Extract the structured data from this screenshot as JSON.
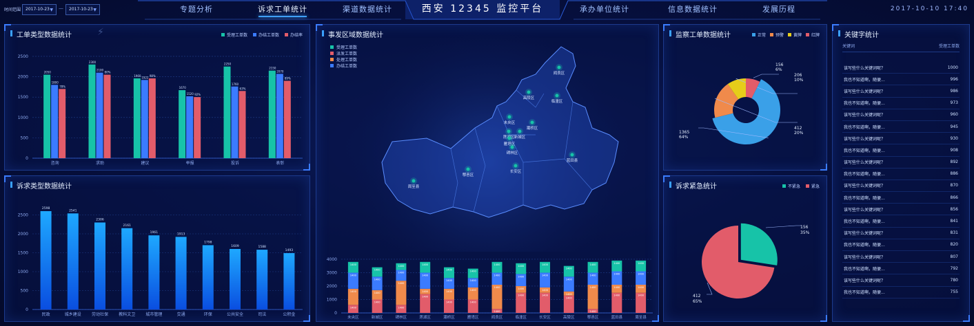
{
  "header": {
    "time_range_label": "时间范围",
    "date_from": "2017-10-23",
    "date_to": "2017-10-23",
    "date_separator": "—",
    "title": "西安 12345 监控平台",
    "datetime": "2017-10-10 17:40",
    "tabs_left": [
      "专题分析",
      "诉求工单统计",
      "渠道数据统计"
    ],
    "tabs_right": [
      "承办单位统计",
      "信息数据统计",
      "发展历程"
    ],
    "active_tab": "诉求工单统计"
  },
  "panels": {
    "order_type": {
      "title": "工单类型数据统计",
      "legend": [
        "受理工单数",
        "办结工单数",
        "办结率"
      ]
    },
    "appeal_type": {
      "title": "诉求类型数据统计"
    },
    "region": {
      "title": "事发区域数据统计",
      "legend": [
        "受理工单数",
        "派发工单数",
        "处理工单数",
        "办结工单数"
      ]
    },
    "supervision": {
      "title": "监察工单数据统计",
      "legend": [
        "正常",
        "预警",
        "黄牌",
        "红牌"
      ]
    },
    "urgency": {
      "title": "诉求紧急统计",
      "legend": [
        "不紧急",
        "紧急"
      ]
    },
    "keywords": {
      "title": "关键字统计",
      "col_keyword": "关键词",
      "col_count": "受理工单数",
      "rows": [
        {
          "k": "该写些什么关键词呢？",
          "v": "1000"
        },
        {
          "k": "我也不知道啊，随便...",
          "v": "996"
        },
        {
          "k": "该写些什么关键词呢？",
          "v": "986"
        },
        {
          "k": "我也不知道啊，随便...",
          "v": "973"
        },
        {
          "k": "该写些什么关键词呢？",
          "v": "960"
        },
        {
          "k": "我也不知道啊，随便...",
          "v": "945"
        },
        {
          "k": "该写些什么关键词呢？",
          "v": "930"
        },
        {
          "k": "我也不知道啊，随便...",
          "v": "908"
        },
        {
          "k": "该写些什么关键词呢？",
          "v": "892"
        },
        {
          "k": "我也不知道啊，随便...",
          "v": "886"
        },
        {
          "k": "该写些什么关键词呢？",
          "v": "870"
        },
        {
          "k": "我也不知道啊，随便...",
          "v": "866"
        },
        {
          "k": "该写些什么关键词呢？",
          "v": "856"
        },
        {
          "k": "我也不知道啊，随便...",
          "v": "841"
        },
        {
          "k": "该写些什么关键词呢？",
          "v": "831"
        },
        {
          "k": "我也不知道啊，随便...",
          "v": "820"
        },
        {
          "k": "该写些什么关键词呢？",
          "v": "807"
        },
        {
          "k": "我也不知道啊，随便...",
          "v": "792"
        },
        {
          "k": "该写些什么关键词呢？",
          "v": "780"
        },
        {
          "k": "我也不知道啊，随便...",
          "v": "755"
        }
      ]
    }
  },
  "map": {
    "districts": [
      "阎良区",
      "高陵区",
      "临潼区",
      "未央区",
      "灞桥区",
      "莲湖区",
      "新城区",
      "雁塔区",
      "碑林区",
      "长安区",
      "鄠邑区",
      "周至县",
      "蓝田县"
    ]
  },
  "colors": {
    "teal": "#17c3a8",
    "blue": "#3b7bff",
    "red": "#e25c6a",
    "orange": "#f08a4b",
    "yellow": "#e6cd1a",
    "sky": "#3aa0e8"
  },
  "chart_data": [
    {
      "id": "order_type",
      "type": "bar",
      "categories": [
        "咨询",
        "求助",
        "建议",
        "举报",
        "投诉",
        "表彰"
      ],
      "series": [
        {
          "name": "受理工单数",
          "values": [
            2050,
            2300,
            1960,
            1670,
            2250,
            2150
          ]
        },
        {
          "name": "办结工单数",
          "values": [
            1800,
            2100,
            1920,
            1520,
            1760,
            2070
          ]
        },
        {
          "name": "办结率",
          "values": [
            1700,
            2050,
            1960,
            1500,
            1650,
            1900
          ]
        }
      ],
      "value_labels": [
        [
          "2050",
          "1800",
          "78%"
        ],
        [
          "2300",
          "2100",
          "80%"
        ],
        [
          "1960",
          "1922",
          "98%"
        ],
        [
          "1670",
          "1520",
          "92%"
        ],
        [
          "2250",
          "1760",
          "63%"
        ],
        [
          "2150",
          "2070",
          "89%"
        ]
      ],
      "yticks": [
        "0",
        "500",
        "1000",
        "1500",
        "2000",
        "2500"
      ],
      "ylim": [
        0,
        2600
      ]
    },
    {
      "id": "appeal_type",
      "type": "bar",
      "categories": [
        "民政",
        "城乡建设",
        "劳动社保",
        "教科文卫",
        "城市管理",
        "交通",
        "环保",
        "公共安全",
        "司法",
        "公积金"
      ],
      "values": [
        2600,
        2540,
        2300,
        2150,
        1960,
        1920,
        1700,
        1600,
        1580,
        1490
      ],
      "value_labels": [
        "2598",
        "2541",
        "2306",
        "2161",
        "1961",
        "1913",
        "1798",
        "1609",
        "1588",
        "1493"
      ],
      "yticks": [
        "0",
        "500",
        "1000",
        "1500",
        "2000",
        "2500"
      ],
      "ylim": [
        0,
        2800
      ]
    },
    {
      "id": "region",
      "type": "bar",
      "stacked": true,
      "categories": [
        "未央区",
        "新城区",
        "碑林区",
        "莲湖区",
        "灞桥区",
        "雁塔区",
        "阎良区",
        "临潼区",
        "长安区",
        "高陵区",
        "鄠邑区",
        "蓝田县",
        "周至县"
      ],
      "series": [
        {
          "name": "受理工单数",
          "values": [
            800,
            700,
            500,
            800,
            800,
            700,
            800,
            800,
            800,
            800,
            800,
            800,
            800
          ]
        },
        {
          "name": "派发工单数",
          "values": [
            600,
            1000,
            600,
            1400,
            1000,
            1000,
            300,
            1500,
            1500,
            1300,
            300,
            1500,
            1500
          ]
        },
        {
          "name": "处理工单数",
          "values": [
            1200,
            700,
            1800,
            400,
            800,
            900,
            1800,
            500,
            400,
            300,
            1800,
            600,
            600
          ]
        },
        {
          "name": "办结工单数",
          "values": [
            1200,
            1000,
            800,
            1200,
            800,
            700,
            900,
            900,
            1100,
            1100,
            900,
            1000,
            1000
          ]
        }
      ],
      "segment_labels": [
        "1400",
        "1400",
        "1400",
        "1400"
      ],
      "yticks": [
        "0",
        "1000",
        "2000",
        "3000",
        "4000"
      ],
      "ylim": [
        0,
        4200
      ]
    },
    {
      "id": "supervision",
      "type": "pie",
      "donut": true,
      "labels": [
        "正常",
        "预警",
        "黄牌",
        "红牌"
      ],
      "values": [
        1365,
        412,
        206,
        156
      ],
      "slice_labels": [
        {
          "value": "1365",
          "pct": "64%"
        },
        {
          "value": "412",
          "pct": "20%"
        },
        {
          "value": "206",
          "pct": "10%"
        },
        {
          "value": "156",
          "pct": "6%"
        }
      ]
    },
    {
      "id": "urgency",
      "type": "pie",
      "labels": [
        "不紧急",
        "紧急"
      ],
      "values": [
        156,
        412
      ],
      "slice_labels": [
        {
          "value": "156",
          "pct": "35%"
        },
        {
          "value": "412",
          "pct": "65%"
        }
      ]
    }
  ]
}
